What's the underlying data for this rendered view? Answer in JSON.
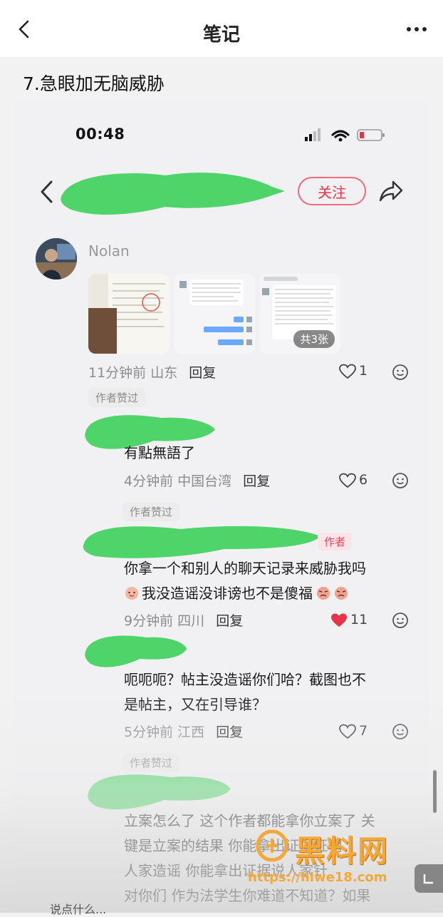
{
  "header": {
    "title": "笔记"
  },
  "post": {
    "headline": "7.急眼加无脑威胁"
  },
  "screenshot": {
    "status_time": "00:48",
    "follow_label": "关注",
    "first_comment": {
      "username": "Nolan",
      "image_count_badge": "共3张",
      "time": "11分钟前",
      "location": "山东",
      "reply_label": "回复",
      "likes": "1"
    },
    "replies": [
      {
        "badge": "作者赞过",
        "text_lines": [
          "有點無語了"
        ],
        "time": "4分钟前",
        "location": "中国台湾",
        "reply_label": "回复",
        "likes": "6",
        "liked": false
      },
      {
        "badge": "作者赞过",
        "author_tag": "作者",
        "text_lines": [
          "你拿一个和别人的聊天记录来威胁我吗",
          "我没造谣没诽谤也不是傻福"
        ],
        "time": "9分钟前",
        "location": "四川",
        "reply_label": "回复",
        "likes": "11",
        "liked": true
      },
      {
        "badge": "",
        "text_lines": [
          "呃呃呃？帖主没造谣你们哈？截图也不",
          "是帖主，又在引导谁？"
        ],
        "time": "5分钟前",
        "location": "江西",
        "reply_label": "回复",
        "likes": "7",
        "liked": false
      },
      {
        "badge": "作者赞过",
        "text_lines": [
          "立案怎么了 这个作者都能拿你立案了 关",
          "键是立案的结果 你能拿出证据证明",
          "人家造谣 你能拿出证据说人家针",
          "对你们 作为法学生你难道不知道？如果"
        ]
      }
    ],
    "bottom_hint": "说点什么..."
  },
  "watermark": {
    "text": "黑料网",
    "url": "https://hlwe18.com"
  },
  "colors": {
    "accent": "#e9344c",
    "blob_green": "#4fd46a",
    "heart_red": "#e8344a",
    "watermark": "#f5a83a"
  }
}
